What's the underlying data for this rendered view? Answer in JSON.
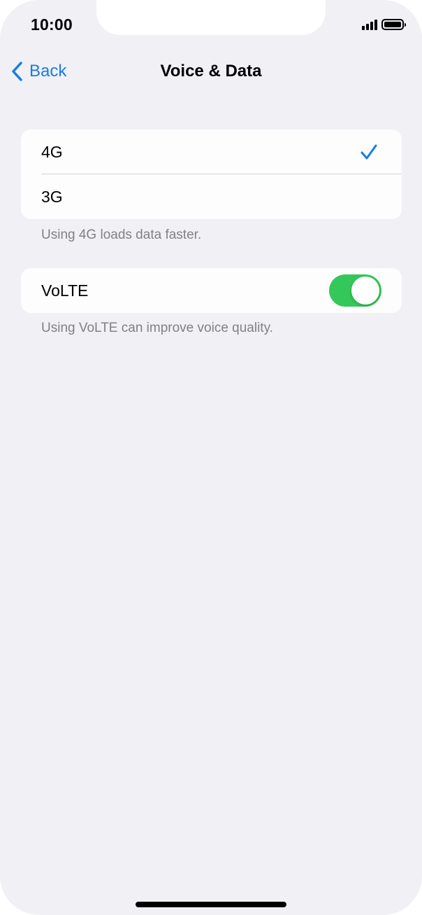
{
  "status_bar": {
    "time": "10:00",
    "signal_icon": "cellular-signal-icon",
    "battery_icon": "battery-full-icon"
  },
  "nav": {
    "back_label": "Back",
    "back_icon": "chevron-left-icon",
    "title": "Voice & Data"
  },
  "network_options": {
    "items": [
      {
        "label": "4G",
        "selected": true
      },
      {
        "label": "3G",
        "selected": false
      }
    ],
    "footer": "Using 4G loads data faster."
  },
  "volte": {
    "label": "VoLTE",
    "enabled": true,
    "footer": "Using VoLTE can improve voice quality."
  },
  "colors": {
    "accent": "#1a7ce0",
    "toggle_on": "#34c759",
    "background": "#f0f0f5"
  }
}
